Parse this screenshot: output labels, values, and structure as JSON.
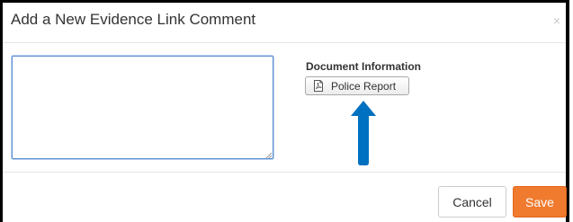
{
  "dialog": {
    "title": "Add a New Evidence Link Comment",
    "close_glyph": "×",
    "comment": {
      "value": "",
      "placeholder": ""
    },
    "document_info": {
      "label": "Document Information",
      "button_label": "Police Report",
      "button_icon": "pdf-file-icon"
    },
    "annotation": {
      "icon": "arrow-up-icon",
      "color": "#0070c0"
    },
    "footer": {
      "cancel_label": "Cancel",
      "save_label": "Save"
    },
    "colors": {
      "save_button": "#f07a2e",
      "textarea_border": "#5b8fd1"
    }
  }
}
